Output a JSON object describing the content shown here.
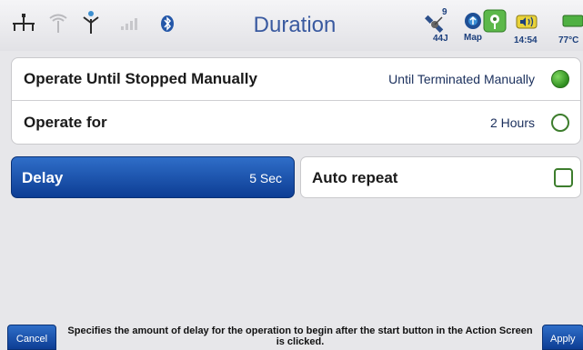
{
  "header": {
    "title": "Duration",
    "status_icons": [
      "network-icon",
      "wifi-icon",
      "antenna-icon",
      "signal-bars-icon",
      "bluetooth-icon",
      "satellite-icon",
      "map-icon",
      "gps-location-icon",
      "speaker-icon",
      "battery-icon"
    ],
    "satellite_count": "9",
    "satellite_label": "44J",
    "map_label": "Map",
    "clock": "14:54",
    "temperature": "77°C"
  },
  "options": {
    "operate_until_stopped": {
      "label": "Operate Until Stopped Manually",
      "value": "Until Terminated Manually",
      "selected": true
    },
    "operate_for": {
      "label": "Operate for",
      "value": "2 Hours",
      "selected": false
    }
  },
  "delay": {
    "label": "Delay",
    "value": "5 Sec"
  },
  "auto_repeat": {
    "label": "Auto repeat",
    "checked": false
  },
  "footer": {
    "cancel_label": "Cancel",
    "apply_label": "Apply",
    "hint": "Specifies the amount of delay for the operation to begin after the start button in the Action Screen is clicked."
  },
  "colors": {
    "accent_blue": "#0d3d94",
    "radio_green": "#2f8d20",
    "title_blue": "#3a5aa0"
  }
}
